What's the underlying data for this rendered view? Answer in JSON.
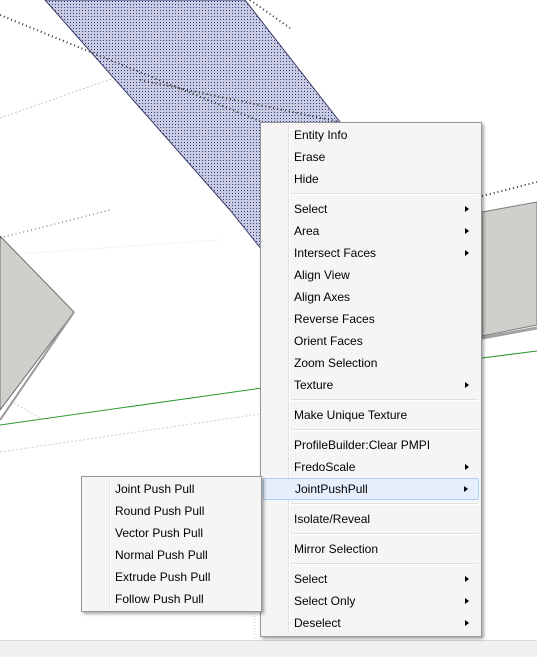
{
  "context_menu": {
    "groups": [
      [
        {
          "label": "Entity Info",
          "submenu": false
        },
        {
          "label": "Erase",
          "submenu": false
        },
        {
          "label": "Hide",
          "submenu": false
        }
      ],
      [
        {
          "label": "Select",
          "submenu": true
        },
        {
          "label": "Area",
          "submenu": true
        },
        {
          "label": "Intersect Faces",
          "submenu": true
        },
        {
          "label": "Align View",
          "submenu": false
        },
        {
          "label": "Align Axes",
          "submenu": false
        },
        {
          "label": "Reverse Faces",
          "submenu": false
        },
        {
          "label": "Orient Faces",
          "submenu": false
        },
        {
          "label": "Zoom Selection",
          "submenu": false
        },
        {
          "label": "Texture",
          "submenu": true
        }
      ],
      [
        {
          "label": "Make Unique Texture",
          "submenu": false
        }
      ],
      [
        {
          "label": "ProfileBuilder:Clear PMPI",
          "submenu": false
        },
        {
          "label": "FredoScale",
          "submenu": true
        },
        {
          "label": "JointPushPull",
          "submenu": true,
          "highlighted": true
        }
      ],
      [
        {
          "label": "Isolate/Reveal",
          "submenu": false
        }
      ],
      [
        {
          "label": "Mirror Selection",
          "submenu": false
        }
      ],
      [
        {
          "label": "Select",
          "submenu": true
        },
        {
          "label": "Select Only",
          "submenu": true
        },
        {
          "label": "Deselect",
          "submenu": true
        }
      ]
    ]
  },
  "jointpushpull_submenu": {
    "items": [
      "Joint Push Pull",
      "Round Push Pull",
      "Vector Push Pull",
      "Normal Push Pull",
      "Extrude Push Pull",
      "Follow Push Pull"
    ]
  },
  "colors": {
    "selected_face_fill": "#c9cbe0",
    "selected_face_dots": "#2b3a8a",
    "face_gray": "#cfd0cc",
    "green_axis": "#2e9a2e",
    "menu_background": "#f5f5f5",
    "menu_highlight": "#e7eefb",
    "menu_highlight_border": "#aecff7"
  }
}
